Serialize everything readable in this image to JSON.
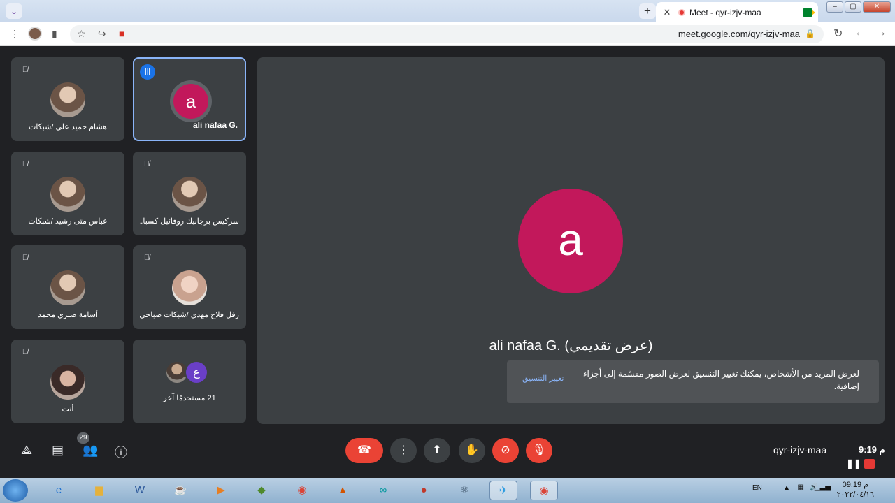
{
  "browser": {
    "tab_title": "Meet - qyr-izjv-maa",
    "url": "meet.google.com/qyr-izjv-maa",
    "new_tab": "+",
    "tab_close": "✕"
  },
  "tiles": [
    {
      "name": "هشام حميد علي /شبكات",
      "muted": true
    },
    {
      "name": "ali nafaa G.",
      "letter": "a",
      "speaking": true
    },
    {
      "name": "عباس متى رشيد /شبكات",
      "muted": true
    },
    {
      "name": "سركيس برجانيك روفائيل كسبا...",
      "muted": true
    },
    {
      "name": "أسامة صبري محمد",
      "muted": true
    },
    {
      "name": "رفل فلاح مهدي /شبكات صباحي",
      "muted": true
    },
    {
      "name": "أنت",
      "muted": true
    },
    {
      "name": "21 مستخدمًا آخر",
      "extra_letter": "ع"
    }
  ],
  "stage": {
    "letter": "a",
    "name": "ali nafaa G. (عرض تقديمي)"
  },
  "toast": {
    "text": "لعرض المزيد من الأشخاص، يمكنك تغيير التنسيق لعرض الصور مقسّمة إلى أجزاء إضافية.",
    "button": "تغيير التنسيق"
  },
  "controls": {
    "participants_count": "29",
    "meeting_code": "qyr-izjv-maa",
    "meeting_time": "م 9:19"
  },
  "taskbar": {
    "lang": "EN",
    "time": "09:19 م",
    "date": "٢٠٢٢/٠٤/١٦"
  },
  "colors": {
    "accent": "#8ab4f8",
    "danger": "#ea4335",
    "avatar": "#c2185b",
    "tile": "#3c4043"
  }
}
